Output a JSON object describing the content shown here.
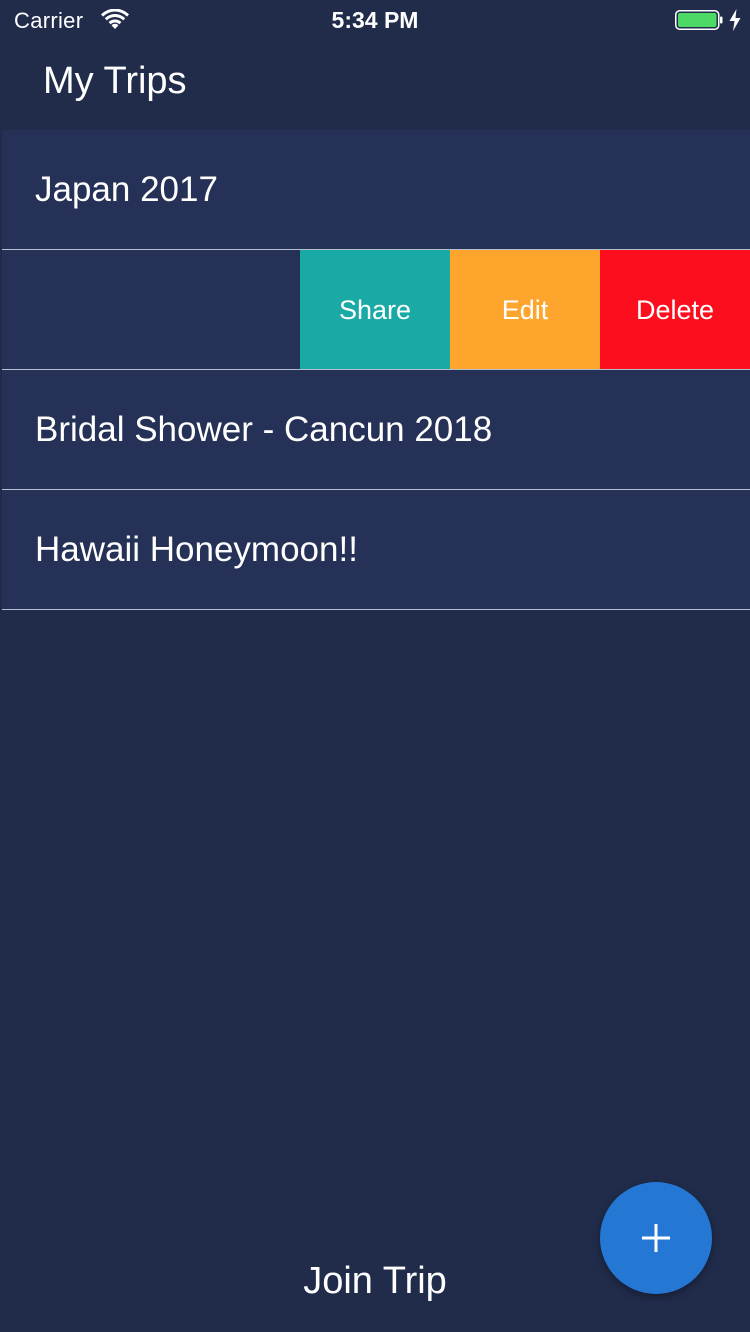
{
  "status_bar": {
    "carrier": "Carrier",
    "time": "5:34 PM",
    "battery_color": "#4cd964"
  },
  "header": {
    "title": "My Trips"
  },
  "trips": [
    {
      "label": "Japan 2017"
    },
    {
      "label": ""
    },
    {
      "label": "Bridal Shower - Cancun 2018"
    },
    {
      "label": "Hawaii Honeymoon!!"
    }
  ],
  "swipe_actions": {
    "share": {
      "label": "Share",
      "color": "#1aaaa6"
    },
    "edit": {
      "label": "Edit",
      "color": "#fea52e"
    },
    "delete": {
      "label": "Delete",
      "color": "#fc0e1e"
    }
  },
  "footer": {
    "join_label": "Join Trip",
    "fab_icon": "plus-icon",
    "fab_color": "#2478d3"
  },
  "colors": {
    "background": "#212c4b",
    "row_background": "#253156",
    "divider": "#b8bfcc"
  }
}
